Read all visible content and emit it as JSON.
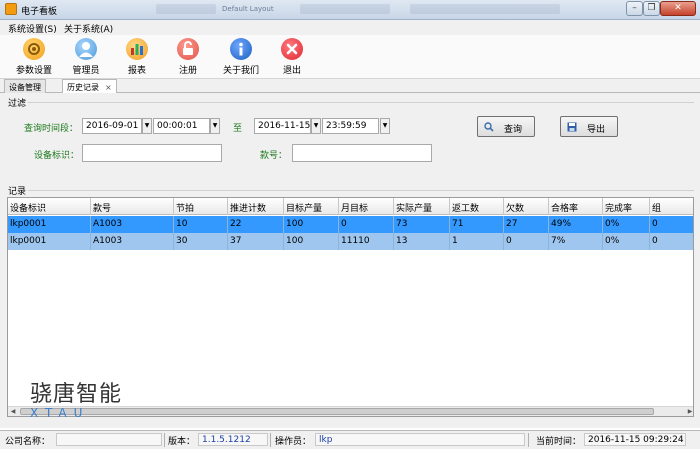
{
  "window": {
    "title": "电子看板",
    "ghost_title": "Default Layout"
  },
  "menu": [
    {
      "label": "系统设置(S)"
    },
    {
      "label": "关于系统(A)"
    }
  ],
  "toolbar": [
    {
      "label": "参数设置",
      "icon": "gear-icon",
      "color": "#f2a01c"
    },
    {
      "label": "管理员",
      "icon": "user-icon",
      "color": "#4a9ad8"
    },
    {
      "label": "报表",
      "icon": "chart-icon",
      "color": "#f29d1e"
    },
    {
      "label": "注册",
      "icon": "lock-icon",
      "color": "#e05248"
    },
    {
      "label": "关于我们",
      "icon": "info-icon",
      "color": "#1a5fbf"
    },
    {
      "label": "退出",
      "icon": "exit-icon",
      "color": "#e0262f"
    }
  ],
  "tabs": [
    {
      "label": "设备管理"
    },
    {
      "label": "历史记录",
      "close": "×"
    }
  ],
  "filter": {
    "section_label": "过滤",
    "query_time_label": "查询时间段：",
    "start_date": "2016-09-01",
    "start_time": "00:00:01",
    "to_label": "至",
    "end_date": "2016-11-15",
    "end_time": "23:59:59",
    "device_id_label": "设备标识：",
    "device_id_value": "",
    "model_label": "款号：",
    "model_value": "",
    "query_button": "查询",
    "export_button": "导出"
  },
  "records": {
    "section_label": "记录",
    "columns": [
      "设备标识",
      "款号",
      "节拍",
      "推进计数",
      "目标产量",
      "月目标",
      "实际产量",
      "返工数",
      "欠数",
      "合格率",
      "完成率",
      "组"
    ],
    "rows": [
      [
        "lkp0001",
        "A1003",
        "10",
        "22",
        "100",
        "0",
        "73",
        "71",
        "27",
        "49%",
        "0%",
        "0"
      ],
      [
        "lkp0001",
        "A1003",
        "30",
        "37",
        "100",
        "11110",
        "13",
        "1",
        "0",
        "7%",
        "0%",
        "0"
      ]
    ]
  },
  "logo": {
    "cn": "骁唐智能",
    "en": "XTAU"
  },
  "status": {
    "company_label": "公司名称：",
    "company_value": "",
    "version_label": "版本：",
    "version_value": "1.1.5.1212",
    "operator_label": "操作员：",
    "operator_value": "lkp",
    "time_label": "当前时间：",
    "time_value": "2016-11-15 09:29:24"
  },
  "colors": {
    "selected_row": "#3399ff",
    "secondary_row": "#9ec6ef",
    "label_green": "#1f7a1f",
    "status_blue": "#1a3ea8"
  }
}
